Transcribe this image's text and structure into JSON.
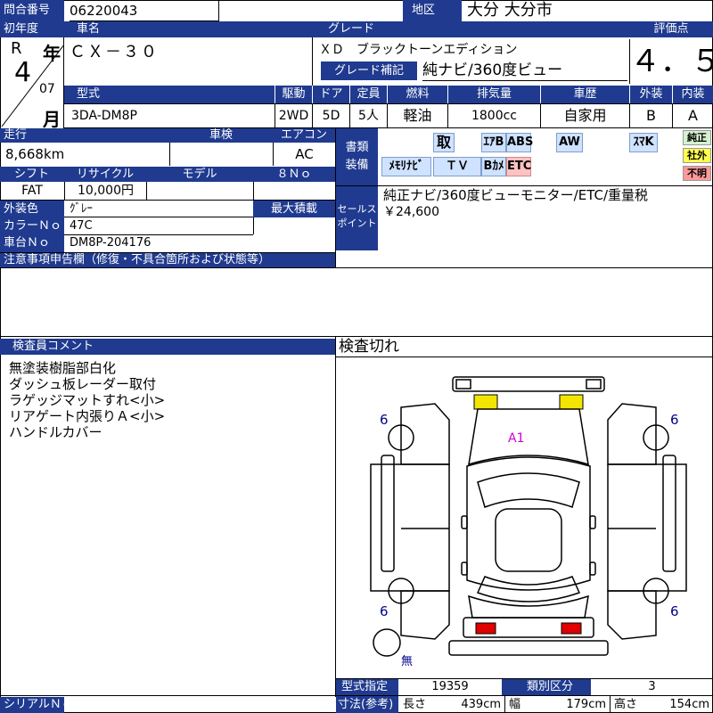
{
  "top": {
    "inquiry_label": "問合番号",
    "inquiry_value": "06220043",
    "region_label": "地区",
    "region_value": "大分 大分市"
  },
  "year": {
    "label": "初年度",
    "era": "R",
    "year_suffix": "年",
    "year_num": "4",
    "month_num": "07",
    "month_suffix": "月"
  },
  "car": {
    "name_label": "車名",
    "name_value": "ＣＸ－３０",
    "grade_label": "グレード",
    "grade_value": "ＸＤ　ブラックトーンエディション",
    "grade_sup_label": "グレード補記",
    "grade_sup_value": "純ナビ/360度ビュー",
    "score_label": "評価点",
    "score_value": "４．５"
  },
  "spec": {
    "headers": [
      "型式",
      "駆動",
      "ドア",
      "定員",
      "燃料",
      "排気量",
      "車歴",
      "外装",
      "内装"
    ],
    "values": [
      "3DA-DM8P",
      "2WD",
      "5D",
      "5人",
      "軽油",
      "1800cc",
      "自家用",
      "B",
      "A"
    ]
  },
  "mileage": {
    "label": "走行",
    "value": "8,668km",
    "inspection_label": "車検",
    "inspection_value": "",
    "ac_label": "エアコン",
    "ac_value": "AC"
  },
  "shift": {
    "shift_label": "シフト",
    "shift_value": "FAT",
    "recycle_label": "リサイクル",
    "recycle_value": "10,000円",
    "model_label": "モデル",
    "model_value": "",
    "no_label": "８Ｎｏ",
    "no_value": ""
  },
  "color": {
    "exterior_label": "外装色",
    "exterior_value": "ｸﾞﾚｰ",
    "load_label": "最大積載",
    "load_value": "",
    "color_no_label": "カラーＮｏ",
    "color_no_value": "47C",
    "chassis_label": "車台Ｎｏ",
    "chassis_value": "DM8P-204176"
  },
  "notes": {
    "label": "注意事項申告欄（修復・不具合箇所および状態等）",
    "value": ""
  },
  "equipment": {
    "label_line1": "書類",
    "label_line2": "装備",
    "row1": [
      {
        "label": "取",
        "on": true
      },
      {
        "label": "ｴｱB",
        "on": true
      },
      {
        "label": "ABS",
        "on": true
      },
      {
        "label": "AW",
        "on": true
      },
      {
        "label": "ｽﾏK",
        "on": true
      }
    ],
    "row2": [
      {
        "label": "ﾒﾓﾘﾅﾋﾞ",
        "on": true
      },
      {
        "label": "ＴＶ",
        "on": true
      },
      {
        "label": "Bｶﾒ",
        "on": true
      },
      {
        "label": "ETC",
        "on": true
      }
    ],
    "tags": [
      {
        "label": "純正",
        "color": "#d7f0d0"
      },
      {
        "label": "社外",
        "color": "#ffff4d"
      },
      {
        "label": "不明",
        "color": "#ff9a9a"
      }
    ]
  },
  "sales": {
    "label_line1": "セールス",
    "label_line2": "ポイント",
    "line1": "純正ナビ/360度ビューモニター/ETC/重量税",
    "line2": "￥24,600"
  },
  "inspector": {
    "label": "検査員コメント",
    "lines": [
      "無塗装樹脂部白化",
      "ダッシュ板レーダー取付",
      "ラゲッジマットすれ<小>",
      "リアゲート内張りＡ<小>",
      "ハンドルカバー"
    ]
  },
  "diagram": {
    "title": "検査切れ",
    "damage_label": "A1",
    "tire_fl": "6",
    "tire_fr": "6",
    "tire_rl": "6",
    "tire_rr": "6",
    "spare_label": "無",
    "highlight_front": "#f2e600",
    "highlight_rear": "#e00000",
    "damage_color": "#d000d0"
  },
  "bottom": {
    "serial_label": "シリアルＮｏ",
    "serial_value": "",
    "type_cert_label": "型式指定",
    "type_cert_value": "19359",
    "class_label": "類別区分",
    "class_value": "3",
    "dims_label": "寸法(参考)",
    "length_label": "長さ",
    "length_value": "439cm",
    "width_label": "幅",
    "width_value": "179cm",
    "height_label": "高さ",
    "height_value": "154cm"
  }
}
